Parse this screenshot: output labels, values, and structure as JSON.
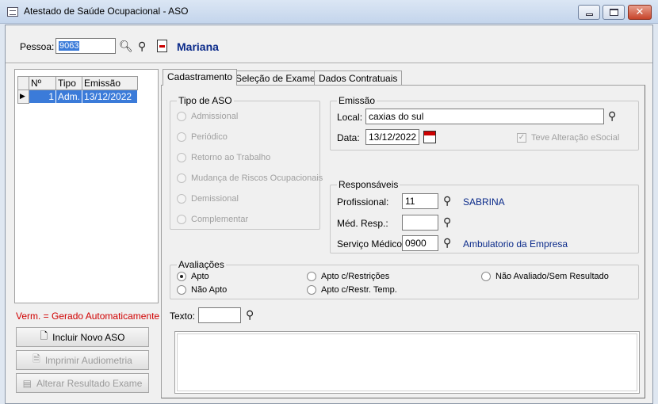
{
  "window": {
    "title": "Atestado de Saúde Ocupacional - ASO"
  },
  "pessoa": {
    "label": "Pessoa:",
    "code": "9063",
    "name": "Mariana"
  },
  "list": {
    "columns": [
      "Nº",
      "Tipo",
      "Emissão"
    ],
    "rows": [
      {
        "num": "1",
        "tipo": "Adm.",
        "emissao": "13/12/2022"
      }
    ]
  },
  "legend": "Verm. = Gerado Automaticamente",
  "buttons": {
    "incluir": "Incluir Novo ASO",
    "imprimir": "Imprimir Audiometria",
    "alterar": "Alterar Resultado Exame"
  },
  "tabs": [
    "Cadastramento",
    "Seleção de Exames",
    "Dados Contratuais"
  ],
  "tipo_aso": {
    "title": "Tipo de ASO",
    "options": [
      "Admissional",
      "Periódico",
      "Retorno ao Trabalho",
      "Mudança de Riscos Ocupacionais",
      "Demissional",
      "Complementar"
    ]
  },
  "emissao": {
    "title": "Emissão",
    "local_label": "Local:",
    "local_value": "caxias do sul",
    "data_label": "Data:",
    "data_value": "13/12/2022",
    "esocial_label": "Teve Alteração eSocial"
  },
  "responsaveis": {
    "title": "Responsáveis",
    "profissional_label": "Profissional:",
    "profissional_code": "11",
    "profissional_name": "SABRINA",
    "medico_label": "Méd. Resp.:",
    "medico_code": "",
    "servico_label": "Serviço Médico:",
    "servico_code": "0900",
    "servico_name": "Ambulatorio da Empresa"
  },
  "avaliacoes": {
    "title": "Avaliações",
    "options": [
      "Apto",
      "Apto c/Restrições",
      "Não Avaliado/Sem Resultado",
      "Não Apto",
      "Apto c/Restr. Temp."
    ],
    "selected": "Apto"
  },
  "texto": {
    "label": "Texto:",
    "code": ""
  }
}
